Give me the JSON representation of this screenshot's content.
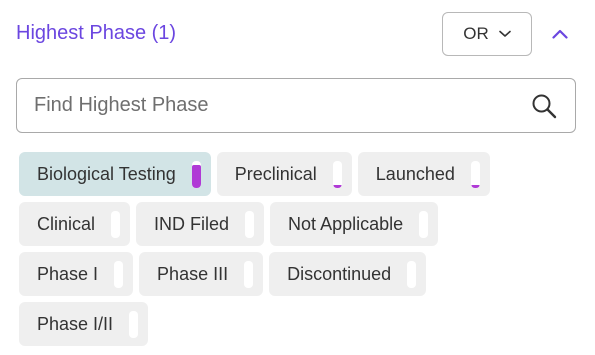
{
  "header": {
    "title": "Highest Phase (1)",
    "operator_label": "OR"
  },
  "search": {
    "placeholder": "Find Highest Phase"
  },
  "colors": {
    "title": "#6b46e0",
    "accent_bar": "#b03ad6",
    "selected_chip_bg": "#d2e4e6",
    "chip_bg": "#efefef"
  },
  "chips": [
    {
      "label": "Biological Testing",
      "selected": true,
      "fill": 0.85
    },
    {
      "label": "Preclinical",
      "selected": false,
      "fill": 0.08
    },
    {
      "label": "Launched",
      "selected": false,
      "fill": 0.08
    },
    {
      "label": "Clinical",
      "selected": false,
      "fill": 0
    },
    {
      "label": "IND Filed",
      "selected": false,
      "fill": 0
    },
    {
      "label": "Not Applicable",
      "selected": false,
      "fill": 0
    },
    {
      "label": "Phase I",
      "selected": false,
      "fill": 0
    },
    {
      "label": "Phase III",
      "selected": false,
      "fill": 0
    },
    {
      "label": "Discontinued",
      "selected": false,
      "fill": 0
    },
    {
      "label": "Phase I/II",
      "selected": false,
      "fill": 0
    }
  ]
}
